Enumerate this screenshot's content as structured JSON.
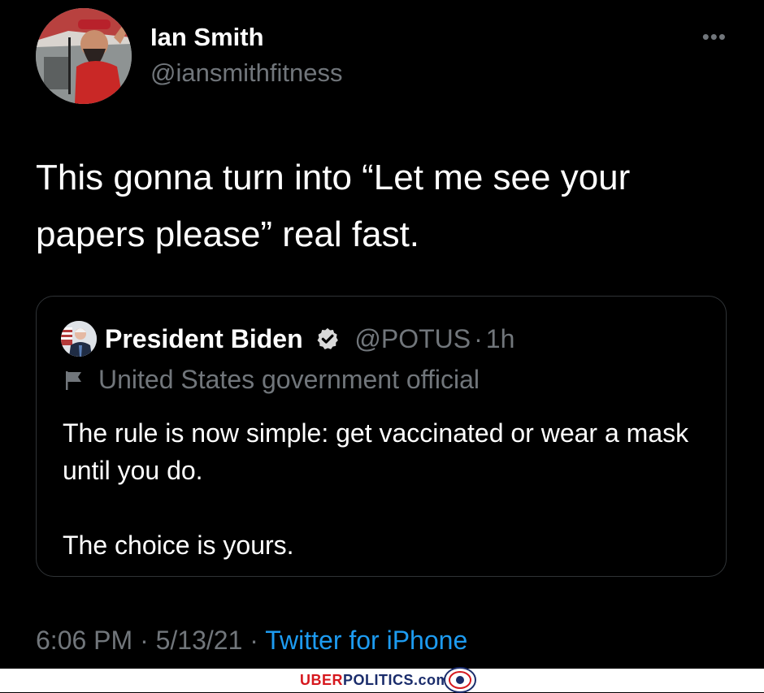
{
  "tweet": {
    "author_name": "Ian Smith",
    "author_handle": "@iansmithfitness",
    "more_icon": "more-icon",
    "text": "This gonna turn into “Let me see your papers please” real fast.",
    "quote": {
      "author_name": "President Biden",
      "verified_icon": "verified-badge-icon",
      "author_handle": "@POTUS",
      "separator": "·",
      "time": "1h",
      "label_icon": "flag-icon",
      "label": "United States government official",
      "text": "The rule is now simple: get vaccinated or wear a mask until you do.\n\nThe choice is yours."
    },
    "footer": {
      "time": "6:06 PM",
      "sep1": "·",
      "date": "5/13/21",
      "sep2": "·",
      "source": "Twitter for iPhone"
    }
  },
  "watermark": {
    "uber": "UBER",
    "rest": "POLITICS.com"
  },
  "colors": {
    "background": "#000000",
    "text": "#ffffff",
    "secondary": "#71767b",
    "link": "#1d9bf0",
    "border": "#2f3336",
    "watermark_red": "#d6181e",
    "watermark_blue": "#1a2c6b"
  }
}
